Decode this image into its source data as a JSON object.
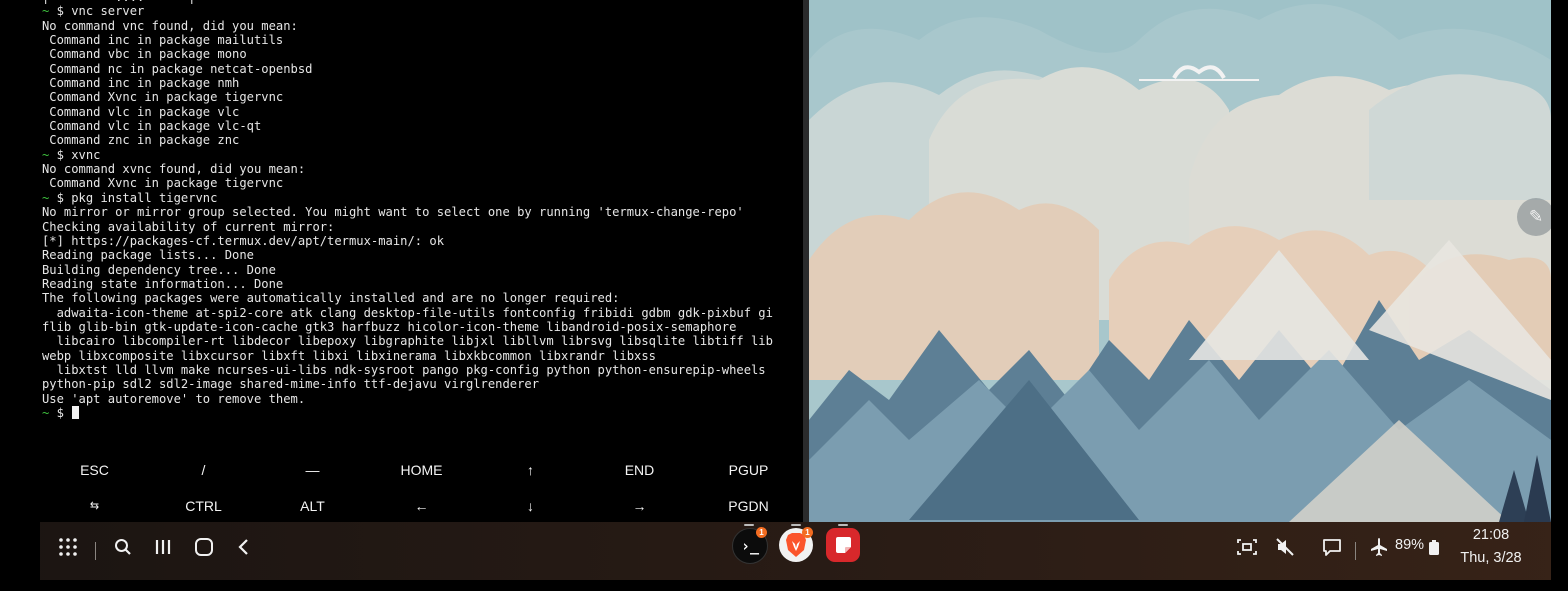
{
  "terminal": {
    "lines": [
      "|         ....      |",
      "~ $ vnc server",
      "No command vnc found, did you mean:",
      " Command inc in package mailutils",
      " Command vbc in package mono",
      " Command nc in package netcat-openbsd",
      " Command inc in package nmh",
      " Command Xvnc in package tigervnc",
      " Command vlc in package vlc",
      " Command vlc in package vlc-qt",
      " Command znc in package znc",
      "~ $ xvnc",
      "No command xvnc found, did you mean:",
      " Command Xvnc in package tigervnc",
      "~ $ pkg install tigervnc",
      "No mirror or mirror group selected. You might want to select one by running 'termux-change-repo'",
      "Checking availability of current mirror:",
      "[*] https://packages-cf.termux.dev/apt/termux-main/: ok",
      "Reading package lists... Done",
      "Building dependency tree... Done",
      "Reading state information... Done",
      "The following packages were automatically installed and are no longer required:",
      "  adwaita-icon-theme at-spi2-core atk clang desktop-file-utils fontconfig fribidi gdbm gdk-pixbuf gi",
      "flib glib-bin gtk-update-icon-cache gtk3 harfbuzz hicolor-icon-theme libandroid-posix-semaphore",
      "  libcairo libcompiler-rt libdecor libepoxy libgraphite libjxl libllvm librsvg libsqlite libtiff lib",
      "webp libxcomposite libxcursor libxft libxi libxinerama libxkbcommon libxrandr libxss",
      "  libxtst lld llvm make ncurses-ui-libs ndk-sysroot pango pkg-config python python-ensurepip-wheels",
      "python-pip sdl2 sdl2-image shared-mime-info ttf-dejavu virglrenderer",
      "Use 'apt autoremove' to remove them.",
      "~ $ "
    ],
    "prompt_color": "#3ec13e"
  },
  "extra_keys": {
    "row1": [
      "ESC",
      "/",
      "—",
      "HOME",
      "↑",
      "END",
      "PGUP"
    ],
    "row2": [
      "⇆",
      "CTRL",
      "ALT",
      "←",
      "↓",
      "→",
      "PGDN"
    ]
  },
  "taskbar": {
    "nav_icons": [
      "apps-grid-icon",
      "search-icon",
      "recents-icon",
      "home-icon",
      "back-icon"
    ],
    "apps": [
      {
        "name": "termux",
        "glyph": "›_",
        "badge": "1",
        "color": "#111111"
      },
      {
        "name": "brave",
        "glyph": "",
        "badge": "1",
        "color": "#f2f2f2"
      },
      {
        "name": "notes",
        "glyph": "",
        "badge": "",
        "color": "#d8282b"
      }
    ],
    "battery": "89%",
    "time": "21:08",
    "date": "Thu, 3/28"
  }
}
